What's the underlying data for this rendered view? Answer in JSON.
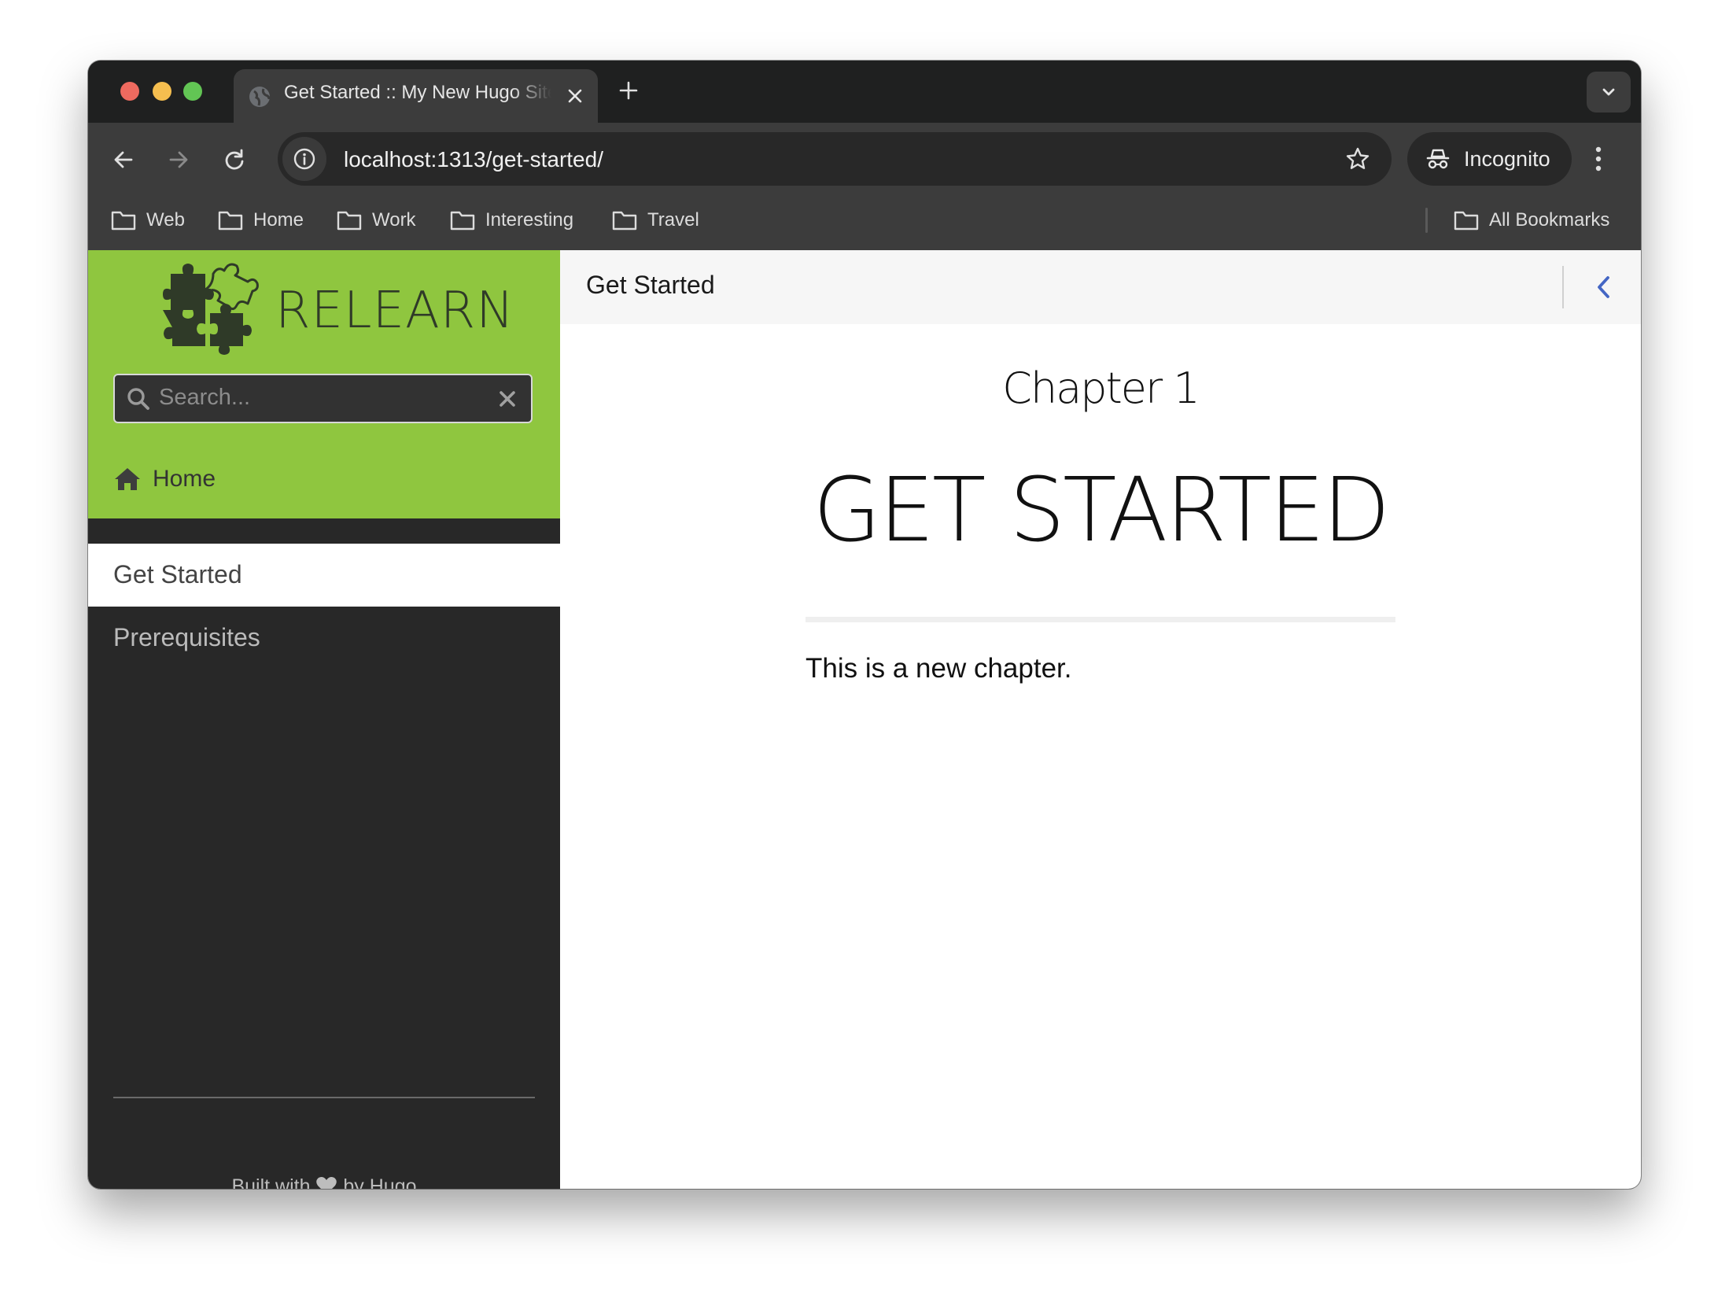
{
  "browser": {
    "tab_title": "Get Started :: My New Hugo Site",
    "url": "localhost:1313/get-started/",
    "profile_label": "Incognito",
    "bookmarks": [
      "Web",
      "Home",
      "Work",
      "Interesting",
      "Travel"
    ],
    "all_bookmarks_label": "All Bookmarks",
    "traffic_colors": {
      "close": "#ee6a5f",
      "minimize": "#f5be4f",
      "zoom": "#62c554"
    }
  },
  "sidebar": {
    "brand": "RELEARN",
    "search_placeholder": "Search...",
    "home_label": "Home",
    "nav_items": [
      {
        "label": "Get Started",
        "active": true
      },
      {
        "label": "Prerequisites",
        "active": false
      }
    ],
    "footer": {
      "prefix": "Built with",
      "suffix": "by Hugo"
    },
    "accent_color": "#8fc63f"
  },
  "main": {
    "breadcrumb": "Get Started",
    "chapter_label": "Chapter 1",
    "title": "GET STARTED",
    "body": "This is a new chapter.",
    "nav_color": "#4466c4"
  }
}
